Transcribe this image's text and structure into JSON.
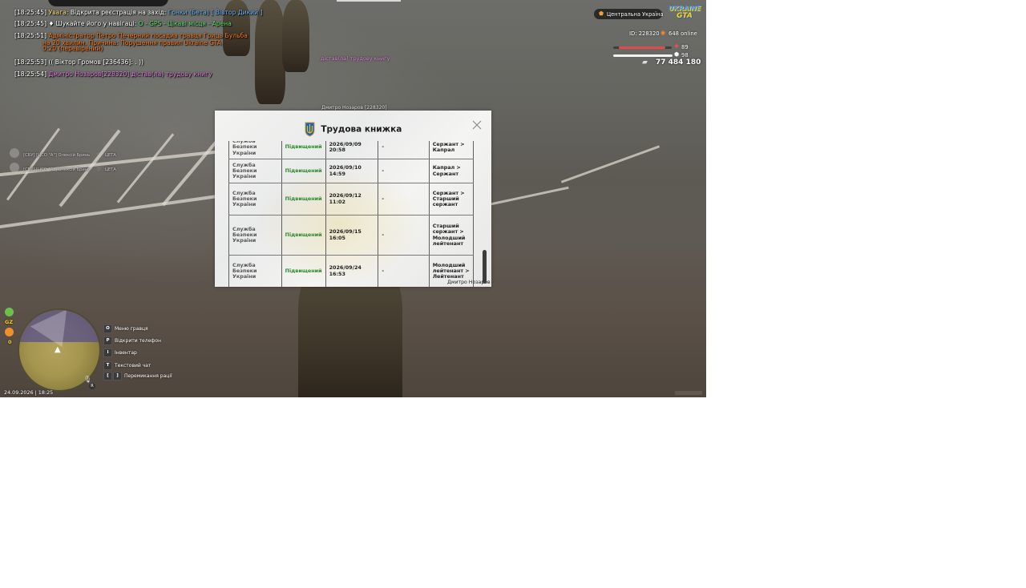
{
  "chat": [
    {
      "time": "[18:25:45]",
      "parts": [
        {
          "text": " Увага: ",
          "color": "yellow"
        },
        {
          "text": "Відкрита реєстрація на захід: ",
          "color": "white"
        },
        {
          "text": "Гонки (Бета) [ Вівтор Дикий ]",
          "color": "blue"
        }
      ]
    },
    {
      "time": "[18:25:45]",
      "parts": [
        {
          "text": " ♦ Шукайте його у навігаці: ",
          "color": "white"
        },
        {
          "text": "O - GPS - Цікаві місця - Арена",
          "color": "green"
        }
      ]
    },
    {
      "time": "[18:25:51]",
      "parts": [
        {
          "text": " Адміністратор Петро Печерний посадив гравця Гриць Бульба",
          "color": "orange"
        }
      ]
    },
    {
      "time": "",
      "parts": [
        {
          "text": "на 20 хвилин. Причина: Порушення правил Ukraine GTA",
          "color": "orange"
        }
      ]
    },
    {
      "time": "",
      "parts": [
        {
          "text": "0:20 (перевірений)",
          "color": "orange"
        }
      ]
    },
    {
      "time": "[18:25:53]",
      "parts": [
        {
          "text": " (( Віктор Громов [236436]: . ))",
          "color": "white"
        }
      ]
    },
    {
      "time": "[18:25:54]",
      "parts": [
        {
          "text": " Дмитро Нозаров[228320] дістав(ла) трудову книгу",
          "color": "purple"
        }
      ]
    }
  ],
  "world_labels": {
    "action_text": "дістав(ла) трудову книгу",
    "player_tag": "Дмитро Нозаров [228320]",
    "npc_tag_1": "[СБУ] [ЦСО \"А\"] Олексій Бринь",
    "npc_tag_1_status": "ЦЕТА",
    "npc_tag_2": "[СБУ] [ЦСО \"А\"] Олексій Бринь",
    "npc_tag_2_status": "ЦЕТА",
    "speaker_name": "Дмитро Нозаров"
  },
  "hud": {
    "server_name": "Центральна Україна",
    "logo_line1": "UKRAINE",
    "logo_line2": "GTA",
    "player_id": "ID: 228320",
    "online": "648 online",
    "health": 89,
    "armor": 98,
    "money": "77 484 180"
  },
  "minimap": {
    "badge_1": "GZ",
    "badge_2": "0",
    "marker": "R"
  },
  "keybinds": [
    {
      "key": "O",
      "label": "Меню гравця"
    },
    {
      "key": "P",
      "label": "Відкрити телефон"
    },
    {
      "key": "I",
      "label": "Інвентар"
    },
    {
      "key": "T",
      "label": "Текстовий чат"
    }
  ],
  "radio_keys": {
    "key1": "[",
    "key2": "]",
    "label": "Перемикання рації"
  },
  "datetime": "24.09.2026 | 18:25",
  "dialog": {
    "title": "Трудова книжка",
    "rows": [
      {
        "org": "Служба Безпеки України",
        "type": "Підвищений",
        "date": "2026/09/09 20:58",
        "dash": "-",
        "rank": "Сержант > Капрал"
      },
      {
        "org": "Служба Безпеки України",
        "type": "Підвищений",
        "date": "2026/09/10 14:59",
        "dash": "-",
        "rank": "Капрал > Сержант"
      },
      {
        "org": "Служба Безпеки України",
        "type": "Підвищений",
        "date": "2026/09/12 11:02",
        "dash": "-",
        "rank": "Сержант > Старший сержант"
      },
      {
        "org": "Служба Безпеки України",
        "type": "Підвищений",
        "date": "2026/09/15 16:05",
        "dash": "-",
        "rank": "Старший сержант > Молодший лейтенант"
      },
      {
        "org": "Служба Безпеки України",
        "type": "Підвищений",
        "date": "2026/09/24 16:53",
        "dash": "-",
        "rank": "Молодший лейтенант > Лейтенант"
      }
    ]
  }
}
